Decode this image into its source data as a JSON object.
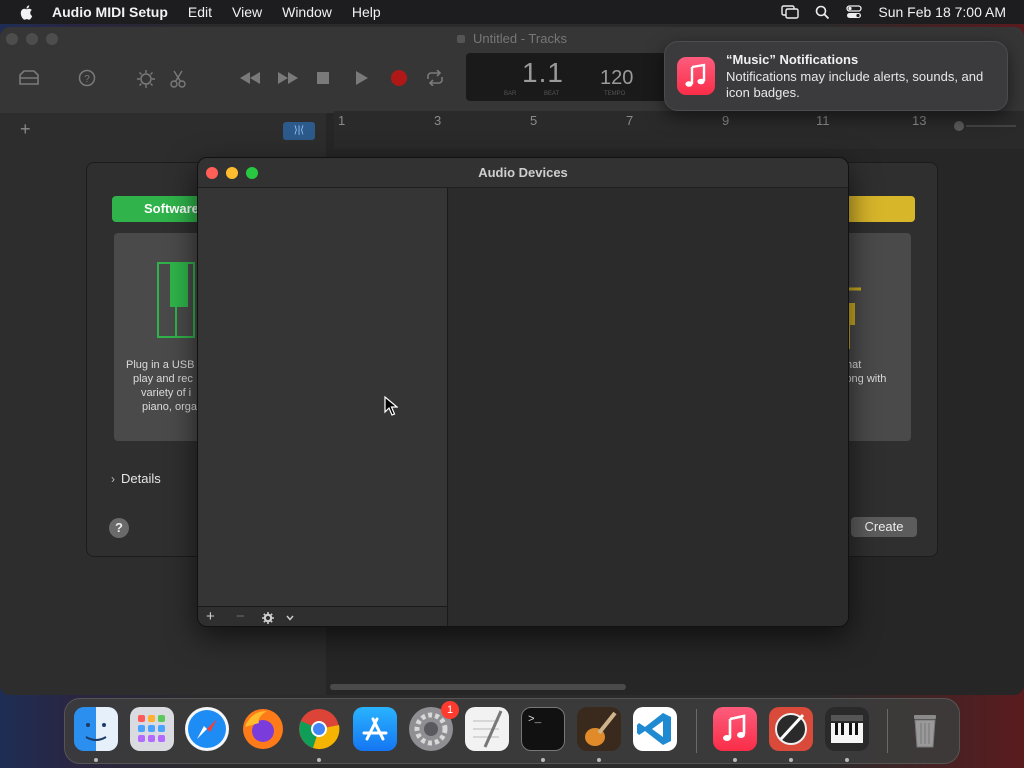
{
  "menubar": {
    "app_name": "Audio MIDI Setup",
    "menus": [
      "Edit",
      "View",
      "Window",
      "Help"
    ],
    "datetime": "Sun Feb 18  7:00 AM"
  },
  "garageband": {
    "title": "Untitled - Tracks",
    "lcd_bar": "1.1",
    "lcd_tempo": "120",
    "lcd_labels": [
      "BAR",
      "BEAT",
      "TEMPO"
    ],
    "ruler_numbers": [
      "1",
      "3",
      "5",
      "7",
      "9",
      "11",
      "13"
    ]
  },
  "new_project_sheet": {
    "software_button": "Software",
    "card_left_text": [
      "Plug in a USB",
      "play and rec",
      "variety of i",
      "piano, orga"
    ],
    "card_right_text": [
      "that",
      "long with"
    ],
    "details_label": "Details",
    "help_label": "?",
    "create_label": "Create"
  },
  "audio_devices": {
    "title": "Audio Devices",
    "add_symbol": "+",
    "remove_symbol": "−"
  },
  "notification": {
    "title": "“Music” Notifications",
    "body": "Notifications may include alerts, sounds, and icon badges."
  },
  "dock": {
    "apps": [
      "Finder",
      "Launchpad",
      "Safari",
      "Firefox",
      "Chrome",
      "App Store",
      "System Settings",
      "TextEdit",
      "Terminal",
      "GarageBand",
      "Visual Studio Code",
      "Music",
      "Instruments",
      "Audio MIDI Setup",
      "Trash"
    ],
    "system_settings_badge": "1",
    "terminal_prompt": ">_"
  },
  "colors": {
    "accent_green": "#2fb34a",
    "accent_yellow": "#d8b62a",
    "close": "#ff5f57",
    "minimize": "#febc2e",
    "zoom": "#28c840",
    "music_red": "#fa2d48"
  }
}
